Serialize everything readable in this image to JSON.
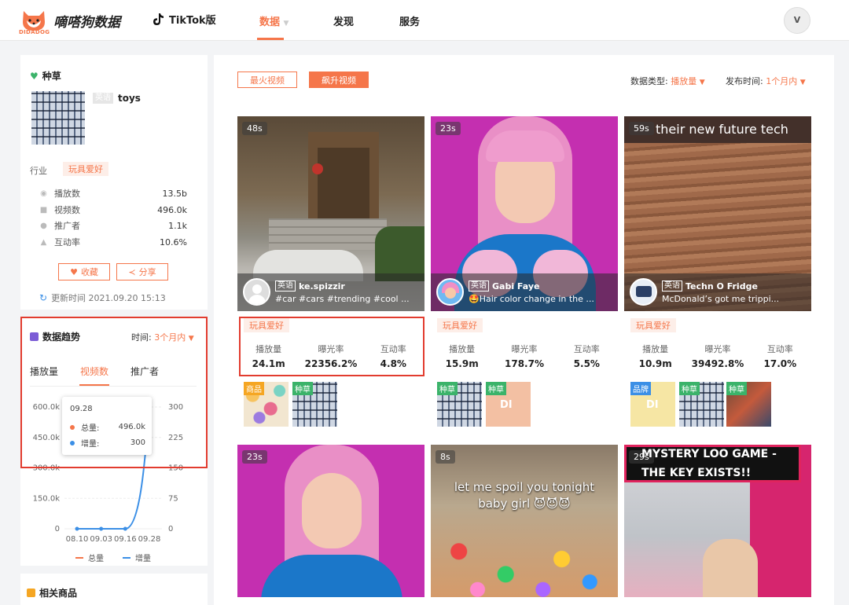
{
  "header": {
    "logo_text": "DIDADOG",
    "brand": "嘀嗒狗数据",
    "platform": "TikTok版",
    "nav": [
      "数据",
      "发现",
      "服务"
    ],
    "avatar_letter": "V"
  },
  "profile": {
    "section_title": "种草",
    "lang": "英语",
    "name": "toys",
    "industry_label": "行业",
    "industry_tag": "玩具爱好",
    "stats": [
      {
        "icon": "play-icon",
        "label": "播放数",
        "value": "13.5b"
      },
      {
        "icon": "video-icon",
        "label": "视频数",
        "value": "496.0k"
      },
      {
        "icon": "user-icon",
        "label": "推广者",
        "value": "1.1k"
      },
      {
        "icon": "thumb-icon",
        "label": "互动率",
        "value": "10.6%"
      }
    ],
    "favorite_label": "收藏",
    "share_label": "分享",
    "update_time": "更新时间 2021.09.20 15:13"
  },
  "trend": {
    "title": "数据趋势",
    "time_label": "时间:",
    "time_value": "3个月内",
    "tabs": [
      "播放量",
      "视频数",
      "推广者"
    ],
    "active_tab": 1,
    "tooltip": {
      "date": "09.28",
      "rows": [
        {
          "label": "总量:",
          "value": "496.0k",
          "color": "#f5764a"
        },
        {
          "label": "增量:",
          "value": "300",
          "color": "#3b8fe6"
        }
      ]
    }
  },
  "chart_data": {
    "type": "line",
    "categories": [
      "08.10",
      "09.03",
      "09.16",
      "09.28"
    ],
    "left_ticks": [
      "600.0k",
      "450.0k",
      "300.0k",
      "150.0k",
      "0"
    ],
    "right_ticks": [
      "300",
      "225",
      "150",
      "75",
      "0"
    ],
    "ylim": [
      0,
      600000
    ],
    "ylim_right": [
      0,
      300
    ],
    "series": [
      {
        "name": "总量",
        "color": "#f5764a",
        "axis": "left",
        "values": [
          null,
          null,
          null,
          496000
        ]
      },
      {
        "name": "增量",
        "color": "#3b8fe6",
        "axis": "right",
        "values": [
          0,
          0,
          0,
          300
        ]
      }
    ]
  },
  "related": {
    "title": "相关商品"
  },
  "main": {
    "segments": [
      "最火视频",
      "飙升视频"
    ],
    "active_segment": 1,
    "filter_type_label": "数据类型:",
    "filter_type_value": "播放量",
    "filter_time_label": "发布时间:",
    "filter_time_value": "1个月内",
    "stat_labels": [
      "播放量",
      "曝光率",
      "互动率"
    ],
    "cards": [
      {
        "duration": "48s",
        "lang": "英语",
        "author": "ke.spizzir",
        "desc": "#car #cars #trending #cool ...",
        "tag": "玩具爱好",
        "plays": "24.1m",
        "exposure": "22356.2%",
        "engagement": "4.8%",
        "minis": [
          {
            "tag": "商品"
          },
          {
            "tag": "种草"
          }
        ]
      },
      {
        "duration": "23s",
        "lang": "英语",
        "author": "Gabi Faye",
        "desc": "🤩Hair color change in the ...",
        "tag": "玩具爱好",
        "plays": "15.9m",
        "exposure": "178.7%",
        "engagement": "5.5%",
        "minis": [
          {
            "tag": "种草"
          },
          {
            "tag": "种草",
            "text": "DI"
          }
        ]
      },
      {
        "duration": "59s",
        "caption": "their new future tech",
        "lang": "英语",
        "author": "Techn O Fridge",
        "desc": "McDonald’s got me trippi...",
        "tag": "玩具爱好",
        "plays": "10.9m",
        "exposure": "39492.8%",
        "engagement": "17.0%",
        "minis": [
          {
            "tag": "品牌",
            "text": "DI"
          },
          {
            "tag": "种草"
          },
          {
            "tag": "种草"
          }
        ]
      },
      {
        "duration": "23s"
      },
      {
        "duration": "8s",
        "caption": "let me spoil you tonight baby girl 😈😈😈"
      },
      {
        "duration": "29s",
        "caption": "MYSTERY LOO GAME - THE KEY EXISTS!!"
      }
    ]
  },
  "colors": {
    "accent": "#f5764a",
    "highlight_border": "#e23c2f",
    "line_blue": "#3b8fe6"
  }
}
